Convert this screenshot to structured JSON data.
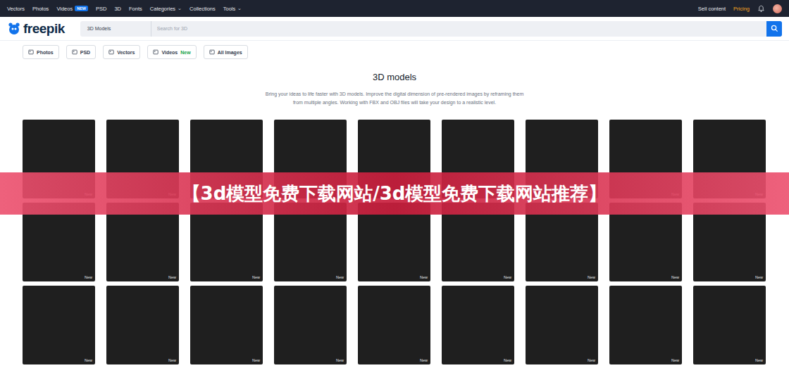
{
  "topbar": {
    "items": [
      {
        "label": "Vectors",
        "badge": "",
        "caret": ""
      },
      {
        "label": "Photos",
        "badge": "",
        "caret": ""
      },
      {
        "label": "Videos",
        "badge": "NEW",
        "caret": ""
      },
      {
        "label": "PSD",
        "badge": "",
        "caret": ""
      },
      {
        "label": "3D",
        "badge": "",
        "caret": ""
      },
      {
        "label": "Fonts",
        "badge": "",
        "caret": ""
      },
      {
        "label": "Categories",
        "badge": "",
        "caret": "⌄"
      },
      {
        "label": "Collections",
        "badge": "",
        "caret": ""
      },
      {
        "label": "Tools",
        "badge": "",
        "caret": "⌄"
      }
    ],
    "sell": "Sell content",
    "pricing": "Pricing"
  },
  "header": {
    "logo": "freepik",
    "category": "3D Models",
    "placeholder": "Search for 3D"
  },
  "chips": [
    {
      "label": "Photos",
      "badge": ""
    },
    {
      "label": "PSD",
      "badge": ""
    },
    {
      "label": "Vectors",
      "badge": ""
    },
    {
      "label": "Videos",
      "badge": "New"
    },
    {
      "label": "All Images",
      "badge": ""
    }
  ],
  "intro": {
    "title": "3D models",
    "lines": [
      "Bring your ideas to life faster with 3D models. Improve the digital dimension of pre-rendered images by reframing them",
      "from multiple angles. Working with FBX and OBJ files will take your design to a realistic level."
    ]
  },
  "cards": [
    {
      "new": "New"
    },
    {
      "new": "New"
    },
    {
      "new": "New"
    },
    {
      "new": "New"
    },
    {
      "new": "New"
    },
    {
      "new": "New"
    },
    {
      "new": "New"
    },
    {
      "new": "New"
    },
    {
      "new": "New"
    },
    {
      "new": "New"
    },
    {
      "new": "New"
    },
    {
      "new": "New"
    },
    {
      "new": "New"
    },
    {
      "new": "New"
    },
    {
      "new": "New"
    },
    {
      "new": "New"
    },
    {
      "new": "New"
    },
    {
      "new": "New"
    },
    {
      "new": "New"
    },
    {
      "new": "New"
    },
    {
      "new": "New"
    },
    {
      "new": "New"
    },
    {
      "new": "New"
    },
    {
      "new": "New"
    },
    {
      "new": "New"
    },
    {
      "new": "New"
    },
    {
      "new": "New"
    }
  ],
  "banner": "【3d模型免费下载网站/3d模型免费下载网站推荐】"
}
